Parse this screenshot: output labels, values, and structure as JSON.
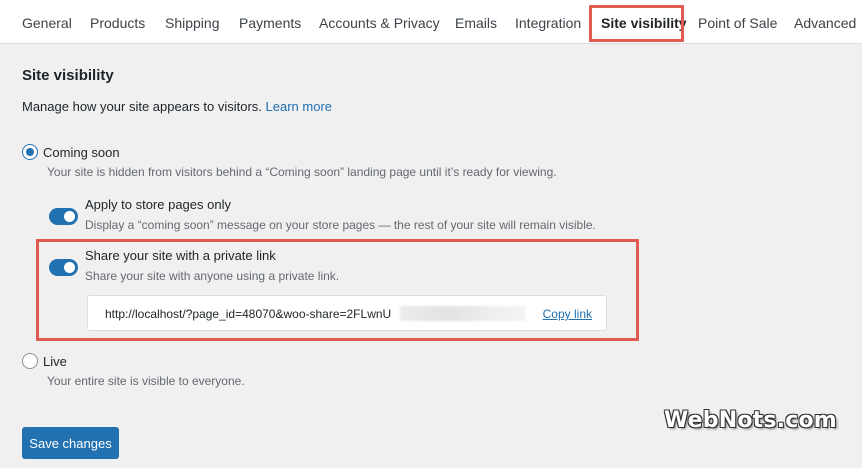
{
  "tabs": [
    {
      "label": "General"
    },
    {
      "label": "Products"
    },
    {
      "label": "Shipping"
    },
    {
      "label": "Payments"
    },
    {
      "label": "Accounts & Privacy"
    },
    {
      "label": "Emails"
    },
    {
      "label": "Integration"
    },
    {
      "label": "Site visibility",
      "active": true
    },
    {
      "label": "Point of Sale"
    },
    {
      "label": "Advanced"
    }
  ],
  "section": {
    "title": "Site visibility",
    "description": "Manage how your site appears to visitors.",
    "learn_more": "Learn more"
  },
  "coming_soon": {
    "label": "Coming soon",
    "help": "Your site is hidden from visitors behind a “Coming soon” landing page until it’s ready for viewing.",
    "selected": true
  },
  "store_pages": {
    "label": "Apply to store pages only",
    "help": "Display a “coming soon” message on your store pages — the rest of your site will remain visible.",
    "enabled": true
  },
  "private_link": {
    "label": "Share your site with a private link",
    "help": "Share your site with anyone using a private link.",
    "enabled": true,
    "url": "http://localhost/?page_id=48070&woo-share=2FLwnU",
    "copy_label": "Copy link"
  },
  "live": {
    "label": "Live",
    "help": "Your entire site is visible to everyone.",
    "selected": false
  },
  "save_label": "Save changes",
  "watermark": "WebNots.com",
  "colors": {
    "accent": "#2271b1",
    "highlight": "#e05a4f",
    "background": "#f0f0f1"
  }
}
